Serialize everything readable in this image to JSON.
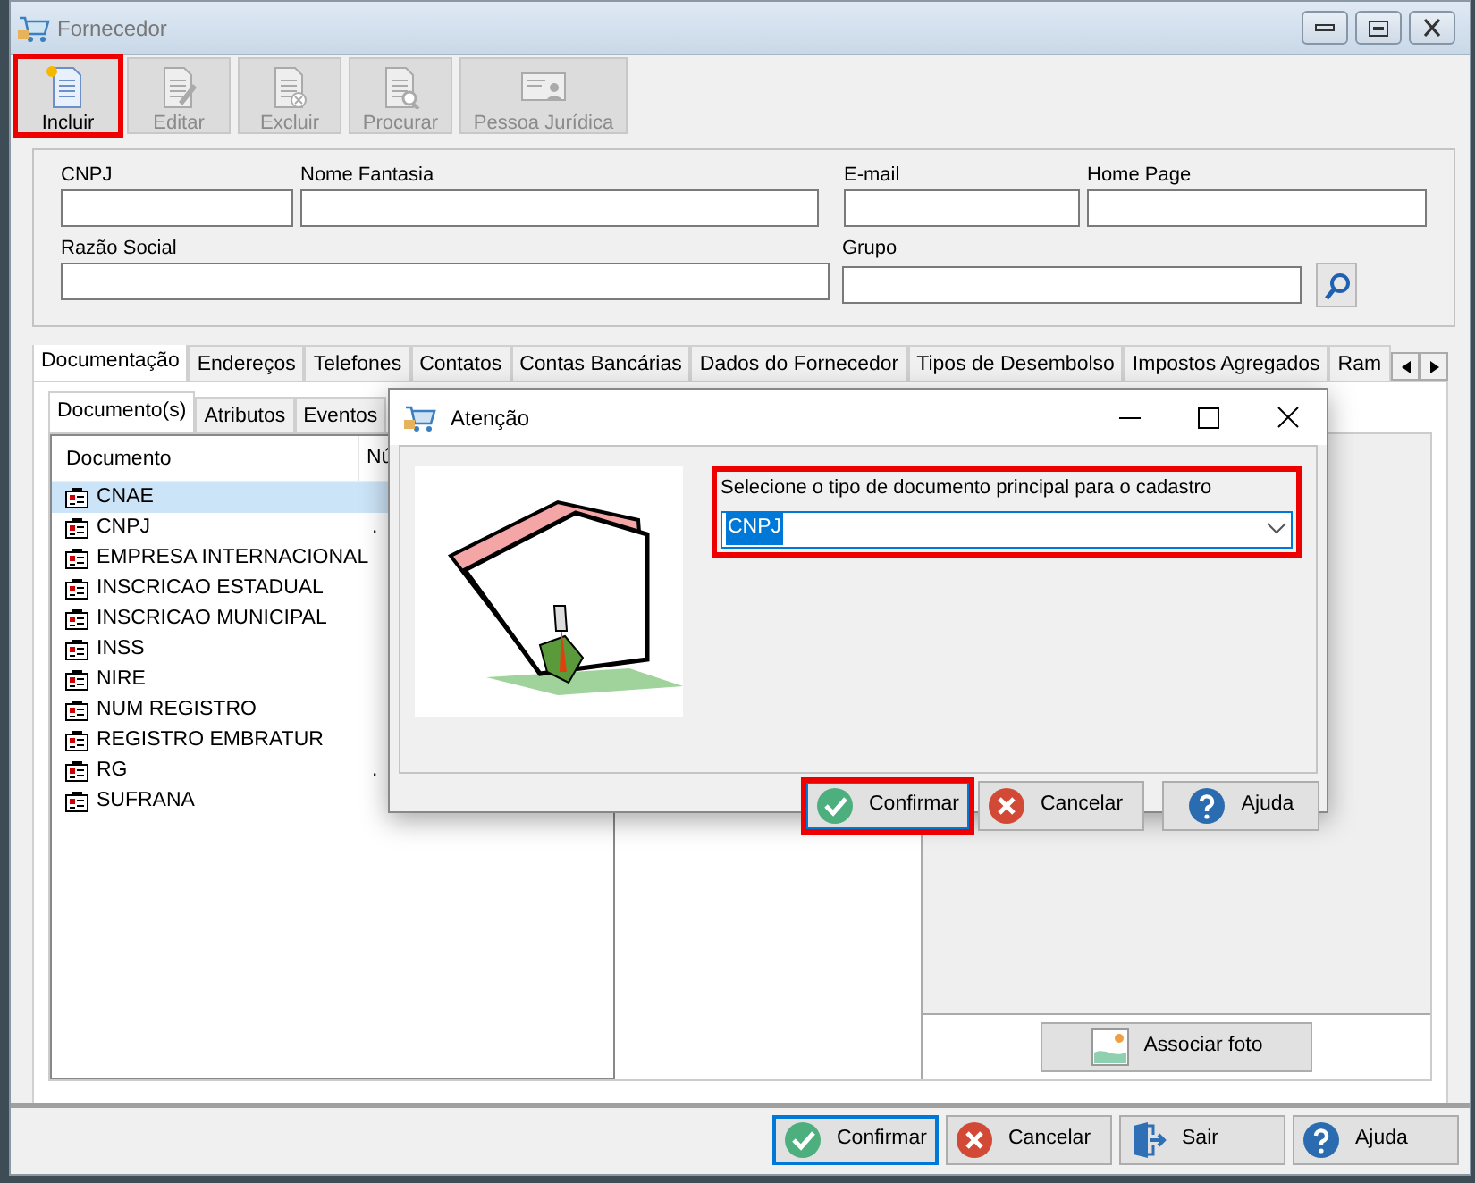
{
  "window": {
    "title": "Fornecedor"
  },
  "toolbar": [
    {
      "label": "Incluir",
      "kind": "new",
      "disabled": false,
      "highlighted": true
    },
    {
      "label": "Editar",
      "kind": "edit",
      "disabled": true,
      "highlighted": false
    },
    {
      "label": "Excluir",
      "kind": "delete",
      "disabled": true,
      "highlighted": false
    },
    {
      "label": "Procurar",
      "kind": "find",
      "disabled": true,
      "highlighted": false
    },
    {
      "label": "Pessoa Jurídica",
      "kind": "card",
      "disabled": true,
      "highlighted": false
    }
  ],
  "form": {
    "fields": [
      {
        "label": "CNPJ"
      },
      {
        "label": "Nome Fantasia"
      },
      {
        "label": "E-mail"
      },
      {
        "label": "Home Page"
      },
      {
        "label": "Razão Social"
      },
      {
        "label": "Grupo",
        "kind": "lookup"
      }
    ]
  },
  "tabs": [
    {
      "label": "Documentação",
      "selected": true
    },
    {
      "label": "Endereços",
      "selected": false
    },
    {
      "label": "Telefones",
      "selected": false
    },
    {
      "label": "Contatos",
      "selected": false
    },
    {
      "label": "Contas Bancárias",
      "selected": false
    },
    {
      "label": "Dados do Fornecedor",
      "selected": false
    },
    {
      "label": "Tipos de Desembolso",
      "selected": false
    },
    {
      "label": "Impostos Agregados",
      "selected": false
    },
    {
      "label": "Ram",
      "selected": false
    }
  ],
  "subtabs": [
    {
      "label": "Documento(s)",
      "selected": true
    },
    {
      "label": "Atributos",
      "selected": false
    },
    {
      "label": "Eventos",
      "selected": false
    }
  ],
  "documents": {
    "columns": [
      "Documento",
      "Nú"
    ],
    "rows": [
      {
        "name": "CNAE",
        "selected": true
      },
      {
        "name": "CNPJ",
        "number": ".",
        "selected": false
      },
      {
        "name": "EMPRESA INTERNACIONAL",
        "selected": false
      },
      {
        "name": "INSCRICAO ESTADUAL",
        "selected": false
      },
      {
        "name": "INSCRICAO MUNICIPAL",
        "selected": false
      },
      {
        "name": "INSS",
        "selected": false
      },
      {
        "name": "NIRE",
        "selected": false
      },
      {
        "name": "NUM REGISTRO",
        "selected": false
      },
      {
        "name": "REGISTRO EMBRATUR",
        "selected": false
      },
      {
        "name": "RG",
        "number": ".",
        "selected": false
      },
      {
        "name": "SUFRANA",
        "selected": false
      }
    ]
  },
  "photo_button": {
    "label": "Associar foto"
  },
  "buttons": [
    {
      "label": "Confirmar",
      "kind": "confirm",
      "focused": true,
      "highlighted": false
    },
    {
      "label": "Cancelar",
      "kind": "cancel",
      "focused": false,
      "highlighted": false
    },
    {
      "label": "Sair",
      "kind": "exit",
      "focused": false,
      "highlighted": false
    },
    {
      "label": "Ajuda",
      "kind": "help",
      "focused": false,
      "highlighted": false
    }
  ],
  "dialog": {
    "title": "Atenção",
    "prompt": "Selecione o tipo de documento principal para o cadastro",
    "select": {
      "value": "CNPJ"
    },
    "highlighted": true,
    "buttons": [
      {
        "label": "Confirmar",
        "kind": "confirm",
        "focused": true,
        "highlighted": true
      },
      {
        "label": "Cancelar",
        "kind": "cancel",
        "focused": false,
        "highlighted": false
      },
      {
        "label": "Ajuda",
        "kind": "help",
        "focused": false,
        "highlighted": false
      }
    ]
  }
}
